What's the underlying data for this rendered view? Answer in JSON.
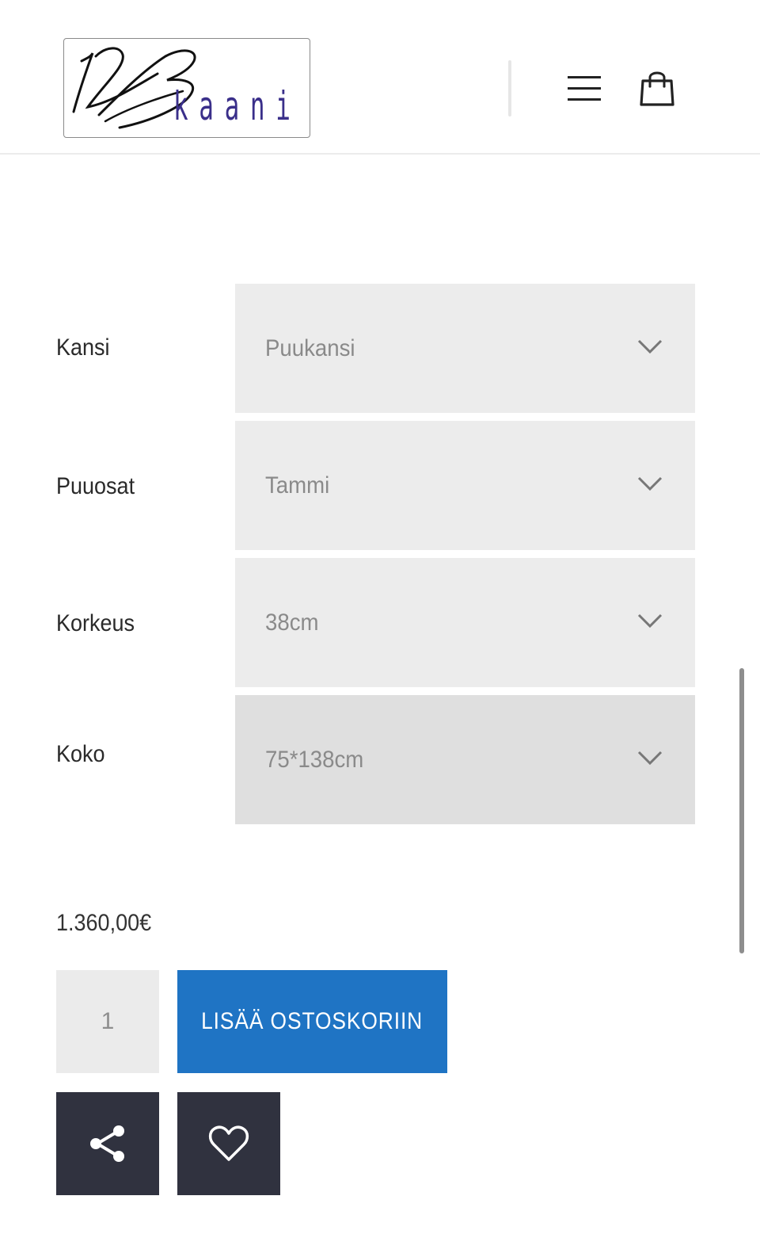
{
  "header": {
    "logo_text": "kaani",
    "logo_mark": "123",
    "icons": {
      "menu": "hamburger-menu-icon",
      "cart": "shopping-bag-icon"
    }
  },
  "options": [
    {
      "label": "Kansi",
      "value": "Puukansi"
    },
    {
      "label": "Puuosat",
      "value": "Tammi"
    },
    {
      "label": "Korkeus",
      "value": "38cm"
    },
    {
      "label": "Koko",
      "value": "75*138cm"
    }
  ],
  "price": "1.360,00€",
  "quantity": "1",
  "add_to_cart_label": "LISÄÄ OSTOSKORIIN",
  "colors": {
    "accent": "#1f74c4",
    "dark_button": "#30323f",
    "select_bg": "#ececec",
    "logo_blue": "#3a2f8a"
  }
}
